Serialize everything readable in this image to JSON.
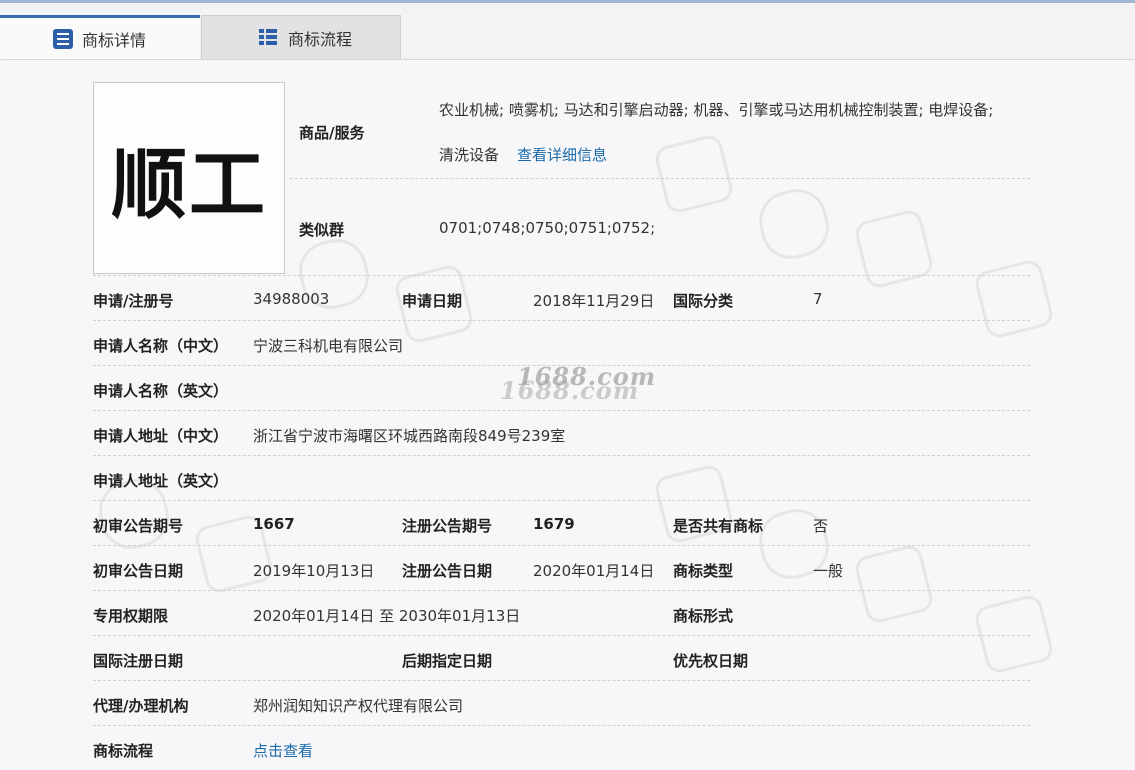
{
  "tabs": [
    {
      "label": "商标详情",
      "active": true,
      "icon": "document-list-icon"
    },
    {
      "label": "商标流程",
      "active": false,
      "icon": "grid-list-icon"
    }
  ],
  "trademark": {
    "logo_text": "顺工"
  },
  "goods": {
    "label": "商品/服务",
    "line1": "农业机械; 喷雾机; 马达和引擎启动器; 机器、引擎或马达用机械控制装置; 电焊设备;",
    "line2": "清洗设备",
    "detail_link": "查看详细信息"
  },
  "similar_group": {
    "label": "类似群",
    "value": "0701;0748;0750;0751;0752;"
  },
  "fields": {
    "reg_no_label": "申请/注册号",
    "reg_no": "34988003",
    "app_date_label": "申请日期",
    "app_date": "2018年11月29日",
    "intl_class_label": "国际分类",
    "intl_class": "7",
    "applicant_cn_label": "申请人名称（中文）",
    "applicant_cn": "宁波三科机电有限公司",
    "applicant_en_label": "申请人名称（英文）",
    "applicant_en": "",
    "address_cn_label": "申请人地址（中文）",
    "address_cn": "浙江省宁波市海曙区环城西路南段849号239室",
    "address_en_label": "申请人地址（英文）",
    "address_en": "",
    "prelim_issue_label": "初审公告期号",
    "prelim_issue": "1667",
    "reg_issue_label": "注册公告期号",
    "reg_issue": "1679",
    "shared_label": "是否共有商标",
    "shared": "否",
    "prelim_date_label": "初审公告日期",
    "prelim_date": "2019年10月13日",
    "reg_date_label": "注册公告日期",
    "reg_date": "2020年01月14日",
    "tm_type_label": "商标类型",
    "tm_type": "一般",
    "exclusive_label": "专用权期限",
    "exclusive": "2020年01月14日 至 2030年01月13日",
    "tm_form_label": "商标形式",
    "tm_form": "",
    "intl_reg_date_label": "国际注册日期",
    "intl_reg_date": "",
    "later_date_label": "后期指定日期",
    "later_date": "",
    "priority_date_label": "优先权日期",
    "priority_date": "",
    "agent_label": "代理/办理机构",
    "agent": "郑州润知知识产权代理有限公司",
    "process_label": "商标流程",
    "process_link": "点击查看"
  },
  "watermark_text": "1688.com",
  "colors": {
    "link": "#1b6aa8",
    "tab_accent": "#3a6bb1",
    "icon_blue": "#2c5fa8"
  }
}
